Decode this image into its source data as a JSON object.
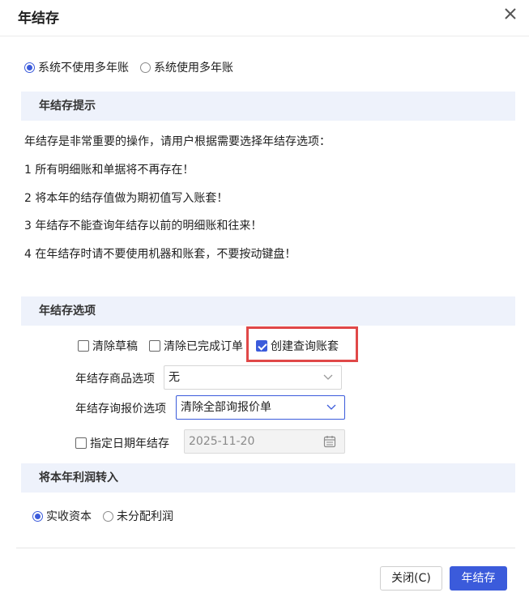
{
  "dialog": {
    "title": "年结存",
    "close_icon": "close-icon"
  },
  "account_mode": {
    "options": [
      {
        "label": "系统不使用多年账",
        "checked": true
      },
      {
        "label": "系统使用多年账",
        "checked": false
      }
    ]
  },
  "tips": {
    "header": "年结存提示",
    "lines": [
      "年结存是非常重要的操作，请用户根据需要选择年结存选项：",
      "1 所有明细账和单据将不再存在！",
      "2 将本年的结存值做为期初值写入账套！",
      "3 年结存不能查询年结存以前的明细账和往来！",
      "4 在年结存时请不要使用机器和账套，不要按动键盘！"
    ]
  },
  "options": {
    "header": "年结存选项",
    "checkboxes": [
      {
        "label": "清除草稿",
        "checked": false
      },
      {
        "label": "清除已完成订单",
        "checked": false
      },
      {
        "label": "创建查询账套",
        "checked": true
      }
    ],
    "goods_label": "年结存商品选项",
    "goods_value": "无",
    "quote_label": "年结存询报价选项",
    "quote_value": "清除全部询报价单",
    "date_label": "指定日期年结存",
    "date_checked": false,
    "date_value": "2025-11-20",
    "highlight_color": "#e04848"
  },
  "profit": {
    "header": "将本年利润转入",
    "options": [
      {
        "label": "实收资本",
        "checked": true
      },
      {
        "label": "未分配利润",
        "checked": false
      }
    ]
  },
  "footer": {
    "close_label": "关闭(C)",
    "confirm_label": "年结存"
  },
  "colors": {
    "accent": "#3b5bdb",
    "section_bg": "#eef2fb",
    "highlight": "#e04848"
  }
}
